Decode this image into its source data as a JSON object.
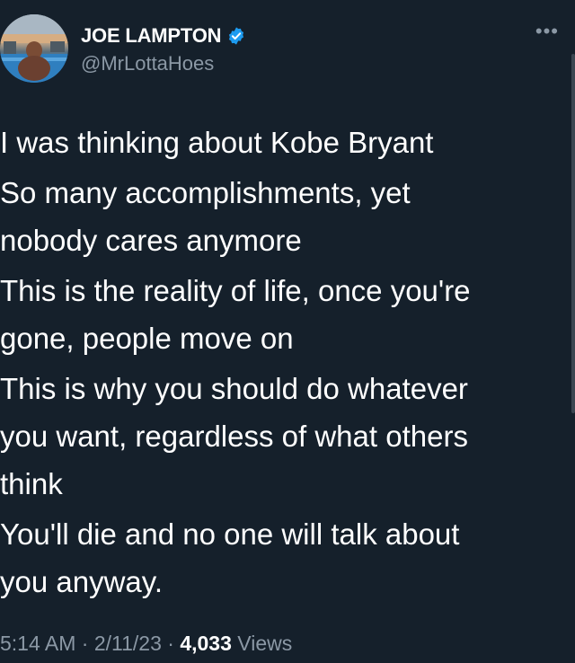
{
  "tweet": {
    "author": {
      "name": "JOE LAMPTON",
      "handle": "@MrLottaHoes",
      "verified": true
    },
    "more_icon": "•••",
    "lines": [
      "I was thinking about Kobe Bryant",
      "So many accomplishments, yet",
      "nobody cares anymore",
      "This is the reality of life, once you're",
      "gone, people move on",
      "This is why you should do whatever",
      "you want, regardless of what others",
      "think",
      "You'll die and no one will talk about",
      "you anyway."
    ],
    "meta": {
      "time": "5:14 AM",
      "sep1": " · ",
      "date": "2/11/23",
      "sep2": " · ",
      "views_count": "4,033",
      "views_label": " Views"
    }
  },
  "colors": {
    "background": "#15202b",
    "text": "#ffffff",
    "secondary": "#8b98a5",
    "verified": "#1d9bf0"
  },
  "icons": {
    "verified": "verified-badge-icon",
    "more": "more-options-icon"
  }
}
